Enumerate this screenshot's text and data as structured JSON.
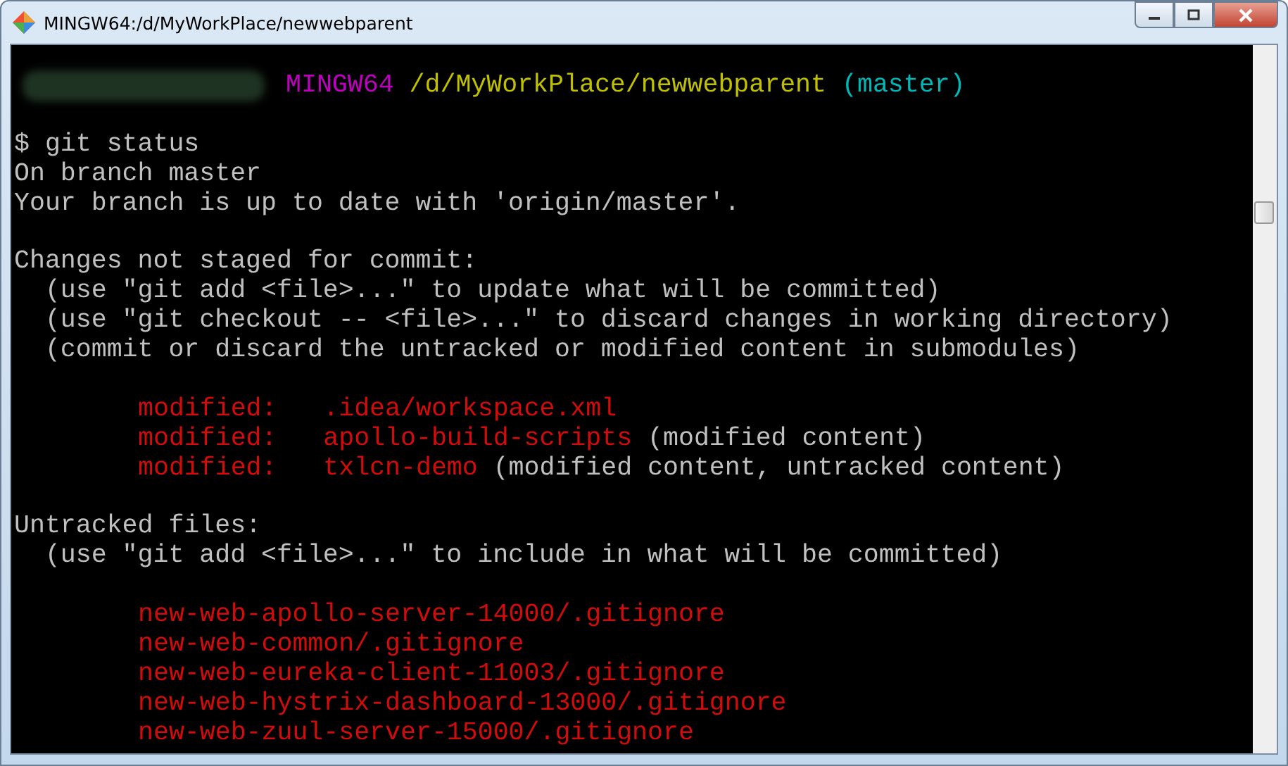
{
  "window": {
    "title": "MINGW64:/d/MyWorkPlace/newwebparent"
  },
  "prompt": {
    "shell": "MINGW64",
    "path": "/d/MyWorkPlace/newwebparent",
    "branch": "(master)"
  },
  "blocks": [
    {
      "indented": false,
      "lines": [
        [
          {
            "kind": "plain",
            "text": "$ git status"
          }
        ],
        [
          {
            "kind": "plain",
            "text": "On branch master"
          }
        ],
        [
          {
            "kind": "plain",
            "text": "Your branch is up to date with 'origin/master'."
          }
        ]
      ]
    },
    {
      "indented": false,
      "lines": [
        [
          {
            "kind": "plain",
            "text": "Changes not staged for commit:"
          }
        ],
        [
          {
            "kind": "plain",
            "text": "  (use \"git add <file>...\" to update what will be committed)"
          }
        ],
        [
          {
            "kind": "plain",
            "text": "  (use \"git checkout -- <file>...\" to discard changes in working directory)"
          }
        ],
        [
          {
            "kind": "plain",
            "text": "  (commit or discard the untracked or modified content in submodules)"
          }
        ]
      ]
    },
    {
      "indented": true,
      "lines": [
        [
          {
            "kind": "modified",
            "text": "modified:   .idea/workspace.xml"
          }
        ],
        [
          {
            "kind": "modified",
            "text": "modified:   apollo-build-scripts"
          },
          {
            "kind": "plain",
            "text": " (modified content)"
          }
        ],
        [
          {
            "kind": "modified",
            "text": "modified:   txlcn-demo"
          },
          {
            "kind": "plain",
            "text": " (modified content, untracked content)"
          }
        ]
      ]
    },
    {
      "indented": false,
      "lines": [
        [
          {
            "kind": "plain",
            "text": "Untracked files:"
          }
        ],
        [
          {
            "kind": "plain",
            "text": "  (use \"git add <file>...\" to include in what will be committed)"
          }
        ]
      ]
    },
    {
      "indented": true,
      "lines": [
        [
          {
            "kind": "modified",
            "text": "new-web-apollo-server-14000/.gitignore"
          }
        ],
        [
          {
            "kind": "modified",
            "text": "new-web-common/.gitignore"
          }
        ],
        [
          {
            "kind": "modified",
            "text": "new-web-eureka-client-11003/.gitignore"
          }
        ],
        [
          {
            "kind": "modified",
            "text": "new-web-hystrix-dashboard-13000/.gitignore"
          }
        ],
        [
          {
            "kind": "modified",
            "text": "new-web-zuul-server-15000/.gitignore"
          }
        ]
      ]
    }
  ]
}
